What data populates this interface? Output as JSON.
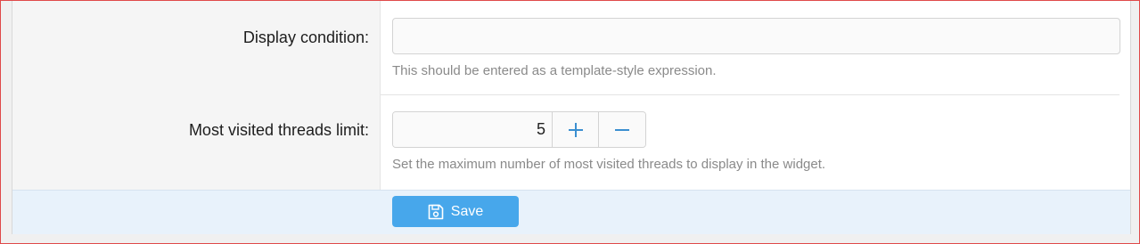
{
  "form": {
    "display_condition": {
      "label": "Display condition:",
      "value": "",
      "placeholder": "",
      "hint": "This should be entered as a template-style expression."
    },
    "threads_limit": {
      "label": "Most visited threads limit:",
      "value": "5",
      "increment_icon": "plus-icon",
      "decrement_icon": "minus-icon",
      "hint": "Set the maximum number of most visited threads to display in the widget."
    }
  },
  "footer": {
    "save_label": "Save",
    "save_icon": "save-icon"
  },
  "colors": {
    "accent": "#47a7eb",
    "footer_bg": "#e8f2fb",
    "label_bg": "#f5f5f5",
    "frame_border": "#e04a4a"
  }
}
